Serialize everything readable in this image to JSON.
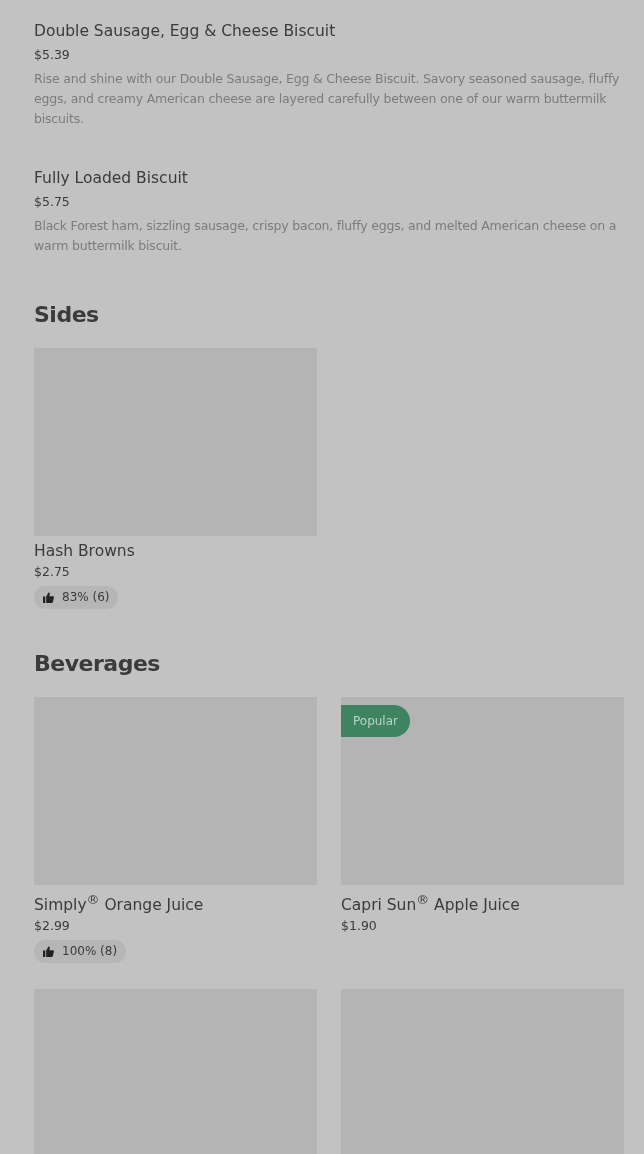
{
  "menu_items": [
    {
      "name": "Double Sausage, Egg & Cheese Biscuit",
      "price": "$5.39",
      "description": "Rise and shine with our Double Sausage, Egg & Cheese Biscuit. Savory seasoned sausage, fluffy eggs, and creamy American cheese are layered carefully between one of our warm buttermilk biscuits."
    },
    {
      "name": "Fully Loaded Biscuit",
      "price": "$5.75",
      "description": "Black Forest ham, sizzling sausage, crispy bacon, fluffy eggs, and melted American cheese on a warm buttermilk biscuit."
    }
  ],
  "sections": [
    {
      "title": "Sides",
      "cards": [
        {
          "kind": "product",
          "name": "Hash Browns",
          "price": "$2.75",
          "rating": "83% (6)"
        }
      ]
    },
    {
      "title": "Beverages",
      "cards": [
        {
          "kind": "product",
          "name": "Simply$^{®}$ Orange Juice",
          "price": "$2.99",
          "rating": "100% (8)"
        },
        {
          "kind": "product",
          "badge": "Popular",
          "name": "Capri Sun$^{®}$ Apple Juice",
          "price": "$1.90"
        },
        {
          "kind": "image-only"
        },
        {
          "kind": "image-only"
        }
      ]
    }
  ]
}
